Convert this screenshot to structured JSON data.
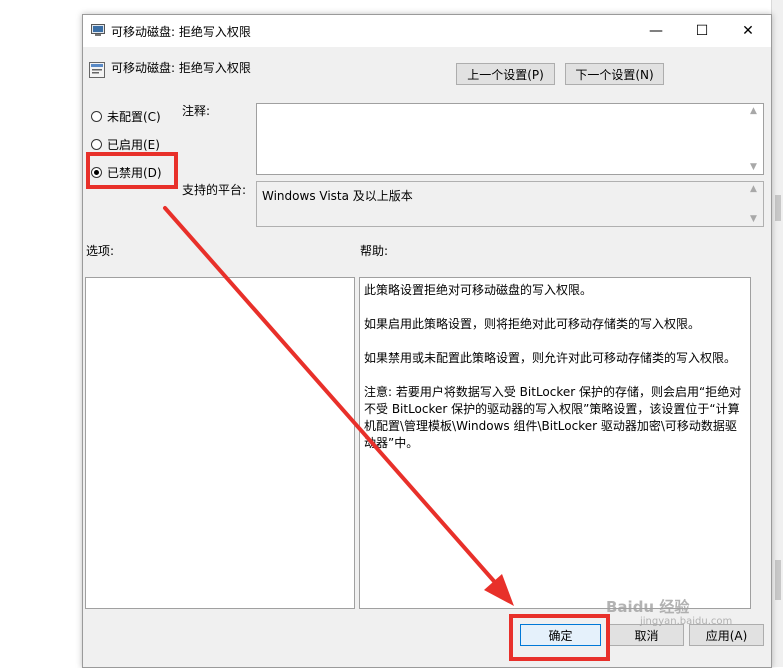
{
  "window": {
    "title": "可移动磁盘: 拒绝写入权限",
    "minimize": "—",
    "maximize": "☐",
    "close": "✕"
  },
  "header": {
    "policy_name": "可移动磁盘: 拒绝写入权限",
    "prev_button": "上一个设置(P)",
    "next_button": "下一个设置(N)"
  },
  "options": {
    "not_configured": "未配置(C)",
    "enabled": "已启用(E)",
    "disabled": "已禁用(D)",
    "selected": "disabled"
  },
  "labels": {
    "comment": "注释:",
    "platform": "支持的平台:",
    "options": "选项:",
    "help": "帮助:"
  },
  "platform_value": "Windows Vista 及以上版本",
  "help_paragraphs": [
    "此策略设置拒绝对可移动磁盘的写入权限。",
    "如果启用此策略设置，则将拒绝对此可移动存储类的写入权限。",
    "如果禁用或未配置此策略设置，则允许对此可移动存储类的写入权限。",
    "注意: 若要用户将数据写入受 BitLocker 保护的存储，则会启用“拒绝对不受 BitLocker 保护的驱动器的写入权限”策略设置，该设置位于“计算机配置\\管理模板\\Windows 组件\\BitLocker 驱动器加密\\可移动数据驱动器”中。"
  ],
  "footer": {
    "ok": "确定",
    "cancel": "取消",
    "apply": "应用(A)"
  },
  "watermark": {
    "brand": "Baidu 经验",
    "url": "jingyan.baidu.com"
  },
  "colors": {
    "annotation_red": "#e8302a",
    "dialog_bg": "#f0f0f0",
    "button_bg": "#e1e1e1"
  }
}
